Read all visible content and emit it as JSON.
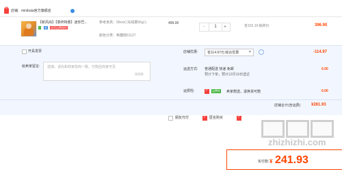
{
  "store": {
    "label": "店铺:",
    "name": "minibala官方旗舰店"
  },
  "item": {
    "title": "【新风尚】【季终特惠】迷你巴...",
    "badge_7": "7",
    "badge_tm": "享",
    "badge_promo": "退货运费保险",
    "attr_size": "参考身高：90cm(（充绒量56g）)",
    "attr_color": "颜色分类：焦糖棕51127",
    "unit_price": "499.00",
    "quantity": "1",
    "minus": "−",
    "plus": "+",
    "discount_note": "省102.10:抽奖价",
    "subtotal": "396.90"
  },
  "panel": {
    "gift_label": "开具发票",
    "message_label": "给卖家留言:",
    "message_placeholder": "选填，请先和商家协商一致，付款后商家可见",
    "message_counter": "0/200",
    "store_discount_label": "店铺优惠:",
    "store_discount_option": "省114.97元:综合优惠",
    "store_discount_value": "-114.97",
    "shipping_label": "运送方式:",
    "shipping_method": "普通配送 快递 免邮",
    "shipping_eta": "预计下单，预计12月19日送达",
    "shipping_value": "0.00",
    "insurance_label": "运费险:",
    "insurance_tag": "运费险",
    "insurance_text": "卖家赠送，退换货可赔",
    "insurance_value": "0.00",
    "store_total_label": "店铺合计(含运费)",
    "store_total_value": "¥281.93"
  },
  "footer": {
    "friend_pay": "朋友代付",
    "anonymous": "匿名购买",
    "pay_label": "实付款:",
    "pay_currency": "¥",
    "pay_amount": "241.93"
  },
  "watermark": {
    "text": "zhizhizhi.com"
  },
  "colors": {
    "accent": "#ff4400",
    "panel_bg": "#f2f7ff",
    "tag_green": "#3cb035",
    "badge_red": "#f5403d",
    "blue": "#3a8fe0"
  }
}
